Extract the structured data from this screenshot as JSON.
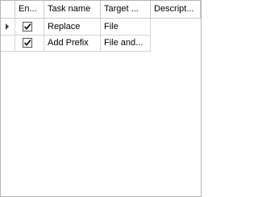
{
  "grid": {
    "columns": [
      {
        "key": "enabled",
        "label": "En..."
      },
      {
        "key": "task_name",
        "label": "Task name"
      },
      {
        "key": "target",
        "label": "Target ..."
      },
      {
        "key": "description",
        "label": "Descript..."
      }
    ],
    "rows": [
      {
        "current": true,
        "enabled": true,
        "task_name": "Replace",
        "target": "File",
        "description": ""
      },
      {
        "current": false,
        "enabled": true,
        "task_name": "Add Prefix",
        "target": "File and...",
        "description": ""
      }
    ]
  },
  "icons": {
    "row_indicator": "current-row-arrow-icon",
    "checkbox_checked": "checkmark-icon"
  },
  "colors": {
    "background": "#ffffff",
    "grid_line": "#d4d4d4",
    "text": "#000000"
  }
}
